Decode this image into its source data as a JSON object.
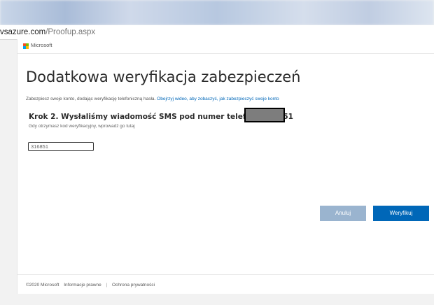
{
  "address_bar": {
    "host": "vsazure.com",
    "path": "/Proofup.aspx"
  },
  "header": {
    "brand": "Microsoft",
    "logo_colors": [
      "#f25022",
      "#7fba00",
      "#00a4ef",
      "#ffb900"
    ]
  },
  "main": {
    "title": "Dodatkowa weryfikacja zabezpieczeń",
    "subline_text": "Zabezpiecz swoje konto, dodając weryfikację telefoniczną hasła.",
    "subline_link": "Obejrzyj wideo, aby zobaczyć, jak zabezpieczyć swoje konto",
    "step_heading": "Krok 2. Wysłaliśmy wiadomość SMS pod numer telefonu +48 51",
    "code_prompt": "Gdy otrzymasz kod weryfikacyjny, wprowadź go tutaj",
    "code_value": "316851"
  },
  "buttons": {
    "cancel": "Anuluj",
    "verify": "Weryfikuj"
  },
  "footer": {
    "copyright": "©2020 Microsoft",
    "legal": "Informacje prawne",
    "separator": "|",
    "privacy": "Ochrona prywatności"
  },
  "colors": {
    "accent": "#0067b8",
    "cancel_button": "#9ab4cf",
    "redaction": "#7d7d7d"
  }
}
